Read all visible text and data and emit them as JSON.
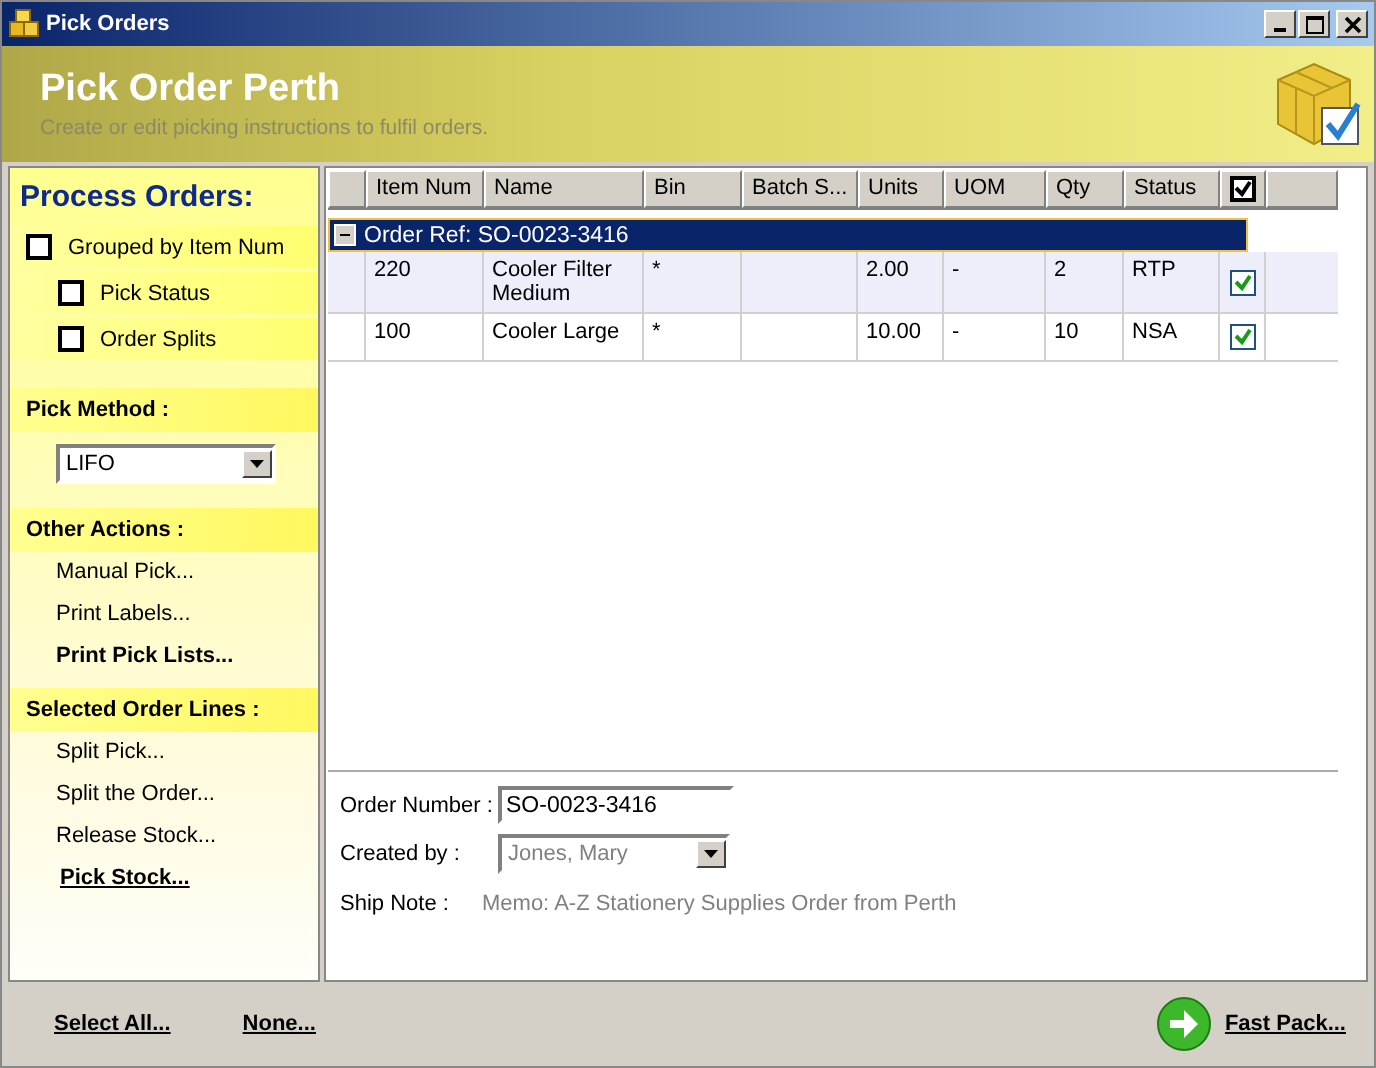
{
  "window": {
    "title": "Pick Orders"
  },
  "header": {
    "title": "Pick Order Perth",
    "subtitle": "Create or edit picking instructions to fulfil orders."
  },
  "sidebar": {
    "title": "Process Orders:",
    "options": [
      {
        "label": "Grouped by Item Num",
        "checked": false,
        "children": [
          {
            "label": "Pick Status",
            "checked": false
          },
          {
            "label": "Order Splits",
            "checked": false
          }
        ]
      }
    ],
    "pick_method": {
      "label": "Pick Method :",
      "value": "LIFO"
    },
    "sections": [
      {
        "label": "Other Actions :",
        "items": [
          {
            "label": "Manual Pick...",
            "kind": "plain"
          },
          {
            "label": "Print Labels...",
            "kind": "plain"
          },
          {
            "label": "Print Pick Lists...",
            "kind": "bold"
          }
        ]
      },
      {
        "label": "Selected Order Lines :",
        "items": [
          {
            "label": "Split Pick...",
            "kind": "plain"
          },
          {
            "label": "Split the Order...",
            "kind": "plain"
          },
          {
            "label": "Release Stock...",
            "kind": "plain"
          },
          {
            "label": "Pick Stock...",
            "kind": "link"
          }
        ]
      }
    ]
  },
  "table": {
    "columns": [
      "Item Num",
      "Name",
      "Bin",
      "Batch S...",
      "Units",
      "UOM",
      "Qty",
      "Status"
    ],
    "header_checked": true,
    "group": {
      "label": "Order Ref: SO-0023-3416",
      "expanded": true
    },
    "rows": [
      {
        "cells": [
          "220",
          "Cooler Filter Medium",
          "*",
          "",
          "2.00",
          "-",
          "2",
          "RTP"
        ],
        "checked": true,
        "selected": true
      },
      {
        "cells": [
          "100",
          "Cooler Large",
          "*",
          "",
          "10.00",
          "-",
          "10",
          "NSA"
        ],
        "checked": true,
        "selected": false
      }
    ]
  },
  "details": {
    "order_number": {
      "label": "Order Number :",
      "value": "SO-0023-3416"
    },
    "created_by": {
      "label": "Created by :",
      "value": "Jones, Mary",
      "disabled": true
    },
    "ship_note": {
      "label": "Ship Note :",
      "value": "Memo: A-Z Stationery Supplies Order from Perth"
    }
  },
  "footer": {
    "links": [
      "Select All...",
      "None..."
    ],
    "fast_pack": "Fast Pack..."
  }
}
